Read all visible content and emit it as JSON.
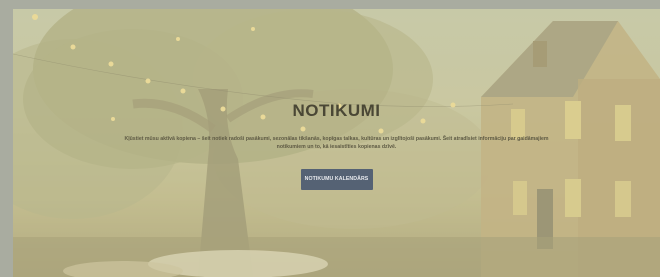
{
  "hero": {
    "title": "NOTIKUMI",
    "description": "Kļūstiet mūsu aktīvā kopiena – šeit notiek radoši pasākumi, sezonālas tikšanās, kopīgas talkas, kultūras un izglītojoši pasākumi. Šeit atradīsiet informāciju par gaidāmajiem notikumiem un to, kā iesaistīties kopienas dzīvē.",
    "button_label": "NOTIKUMU KALENDĀRS"
  },
  "colors": {
    "button_bg": "#556274",
    "title": "#4a4735",
    "page_bg": "#a9aca0"
  },
  "icons": {
    "background": "illustration-tree-house-string-lights"
  }
}
